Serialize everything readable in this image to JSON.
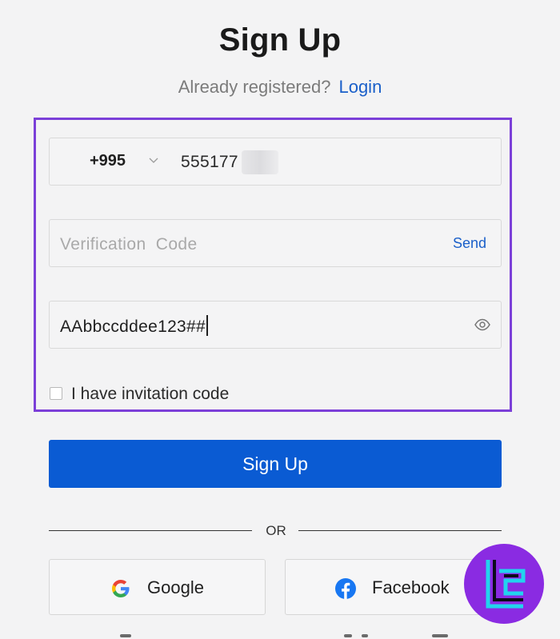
{
  "header": {
    "title": "Sign Up",
    "already_registered": "Already registered?",
    "login_link": "Login"
  },
  "form": {
    "country_code": "+995",
    "phone_number": "555177",
    "verification_placeholder": "Verification Code",
    "send_label": "Send",
    "password_value": "AAbbccddee123##",
    "invitation_checkbox_label": "I have invitation code",
    "invitation_checked": false
  },
  "actions": {
    "signup_label": "Sign Up",
    "or_label": "OR",
    "google_label": "Google",
    "facebook_label": "Facebook"
  },
  "colors": {
    "primary": "#0a5bd3",
    "link": "#1a5fc9",
    "highlight_border": "#7b3fd8",
    "logo_bg": "#8a2be2",
    "logo_mark": "#22d3ee"
  },
  "icons": {
    "country_dropdown": "chevron-down-icon",
    "password_toggle": "eye-icon",
    "google": "google-icon",
    "facebook": "facebook-icon",
    "watermark": "tradingfinder-logo"
  }
}
